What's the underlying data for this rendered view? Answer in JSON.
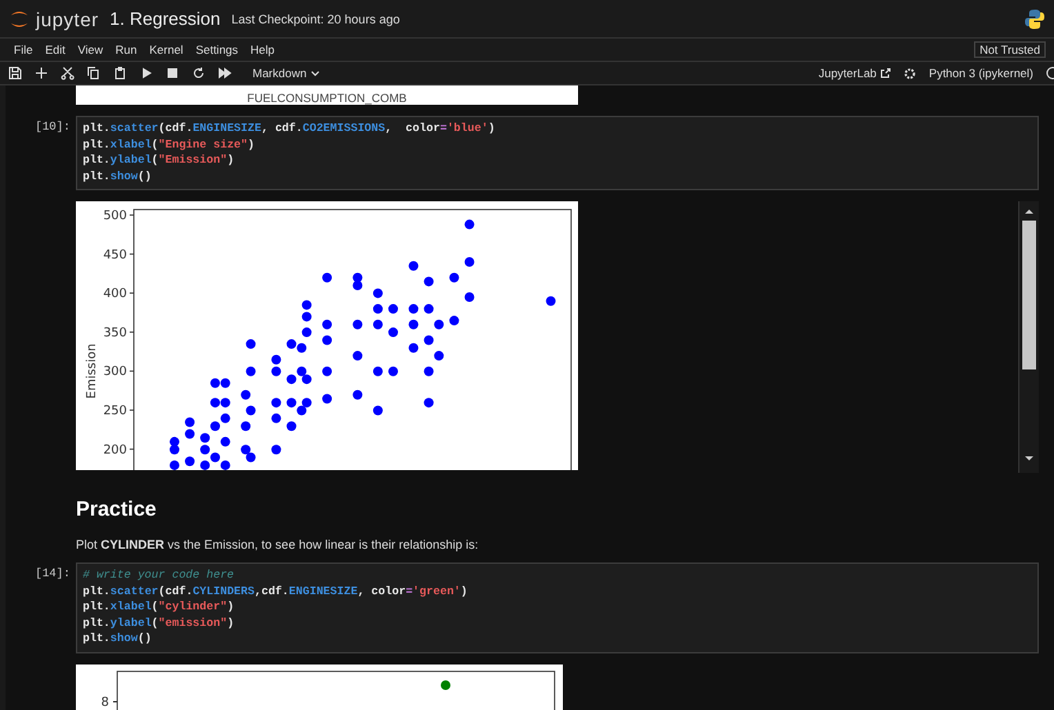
{
  "header": {
    "logo_text": "jupyter",
    "title": "1. Regression",
    "checkpoint": "Last Checkpoint: 20 hours ago"
  },
  "menu": {
    "items": [
      "File",
      "Edit",
      "View",
      "Run",
      "Kernel",
      "Settings",
      "Help"
    ],
    "trust": "Not Trusted"
  },
  "toolbar": {
    "cell_type": "Markdown",
    "jupyterlab": "JupyterLab",
    "kernel": "Python 3 (ipykernel)"
  },
  "cells": [
    {
      "kind": "image-partial",
      "text": "FUELCONSUMPTION_COMB"
    },
    {
      "kind": "code",
      "prompt": "[10]:",
      "lines": [
        [
          {
            "kind": "name",
            "text": "plt."
          },
          {
            "kind": "call",
            "text": "scatter"
          },
          {
            "kind": "name",
            "text": "(cdf."
          },
          {
            "kind": "attr",
            "text": "ENGINESIZE"
          },
          {
            "kind": "name",
            "text": ", cdf."
          },
          {
            "kind": "attr",
            "text": "CO2EMISSIONS"
          },
          {
            "kind": "name",
            "text": ",  color"
          },
          {
            "kind": "op",
            "text": "="
          },
          {
            "kind": "string",
            "text": "'blue'"
          },
          {
            "kind": "name",
            "text": ")"
          }
        ],
        [
          {
            "kind": "name",
            "text": "plt."
          },
          {
            "kind": "call",
            "text": "xlabel"
          },
          {
            "kind": "name",
            "text": "("
          },
          {
            "kind": "string",
            "text": "\"Engine size\""
          },
          {
            "kind": "name",
            "text": ")"
          }
        ],
        [
          {
            "kind": "name",
            "text": "plt."
          },
          {
            "kind": "call",
            "text": "ylabel"
          },
          {
            "kind": "name",
            "text": "("
          },
          {
            "kind": "string",
            "text": "\"Emission\""
          },
          {
            "kind": "name",
            "text": ")"
          }
        ],
        [
          {
            "kind": "name",
            "text": "plt."
          },
          {
            "kind": "call",
            "text": "show"
          },
          {
            "kind": "name",
            "text": "()"
          }
        ]
      ]
    },
    {
      "kind": "chart",
      "ylabel": "Emission",
      "yticks": [
        "500",
        "450",
        "400",
        "350",
        "300",
        "250",
        "200"
      ]
    },
    {
      "kind": "markdown",
      "heading": "Practice",
      "text": "Plot **CYLINDER** vs the Emission, to see how linear is their relationship is:"
    },
    {
      "kind": "code",
      "prompt": "[14]:",
      "lines": [
        [
          {
            "kind": "comment",
            "text": "# write your code here"
          }
        ],
        [
          {
            "kind": "name",
            "text": "plt."
          },
          {
            "kind": "call",
            "text": "scatter"
          },
          {
            "kind": "name",
            "text": "(cdf."
          },
          {
            "kind": "attr",
            "text": "CYLINDERS"
          },
          {
            "kind": "name",
            "text": ",cdf."
          },
          {
            "kind": "attr",
            "text": "ENGINESIZE"
          },
          {
            "kind": "name",
            "text": ", color"
          },
          {
            "kind": "op",
            "text": "="
          },
          {
            "kind": "string",
            "text": "'green'"
          },
          {
            "kind": "name",
            "text": ")"
          }
        ],
        [
          {
            "kind": "name",
            "text": "plt."
          },
          {
            "kind": "call",
            "text": "xlabel"
          },
          {
            "kind": "name",
            "text": "("
          },
          {
            "kind": "string",
            "text": "\"cylinder\""
          },
          {
            "kind": "name",
            "text": ")"
          }
        ],
        [
          {
            "kind": "name",
            "text": "plt."
          },
          {
            "kind": "call",
            "text": "ylabel"
          },
          {
            "kind": "name",
            "text": "("
          },
          {
            "kind": "string",
            "text": "\"emission\""
          },
          {
            "kind": "name",
            "text": ")"
          }
        ],
        [
          {
            "kind": "name",
            "text": "plt."
          },
          {
            "kind": "call",
            "text": "show"
          },
          {
            "kind": "name",
            "text": "()"
          }
        ]
      ]
    },
    {
      "kind": "plot-picture",
      "tick": "8"
    }
  ]
}
